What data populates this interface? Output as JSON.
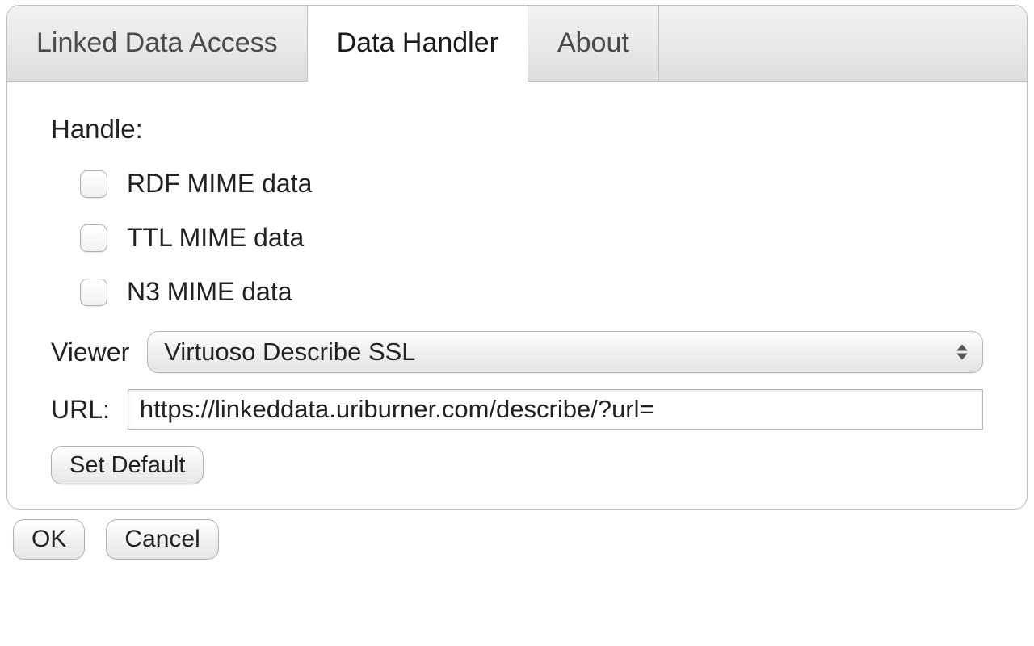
{
  "tabs": [
    {
      "label": "Linked Data Access",
      "active": false
    },
    {
      "label": "Data Handler",
      "active": true
    },
    {
      "label": "About",
      "active": false
    }
  ],
  "handler": {
    "section_label": "Handle:",
    "options": [
      {
        "label": "RDF MIME data",
        "checked": false
      },
      {
        "label": "TTL MIME data",
        "checked": false
      },
      {
        "label": "N3 MIME data",
        "checked": false
      }
    ],
    "viewer_label": "Viewer",
    "viewer_value": "Virtuoso Describe SSL",
    "url_label": "URL:",
    "url_value": "https://linkeddata.uriburner.com/describe/?url=",
    "set_default_label": "Set Default"
  },
  "footer": {
    "ok_label": "OK",
    "cancel_label": "Cancel"
  }
}
